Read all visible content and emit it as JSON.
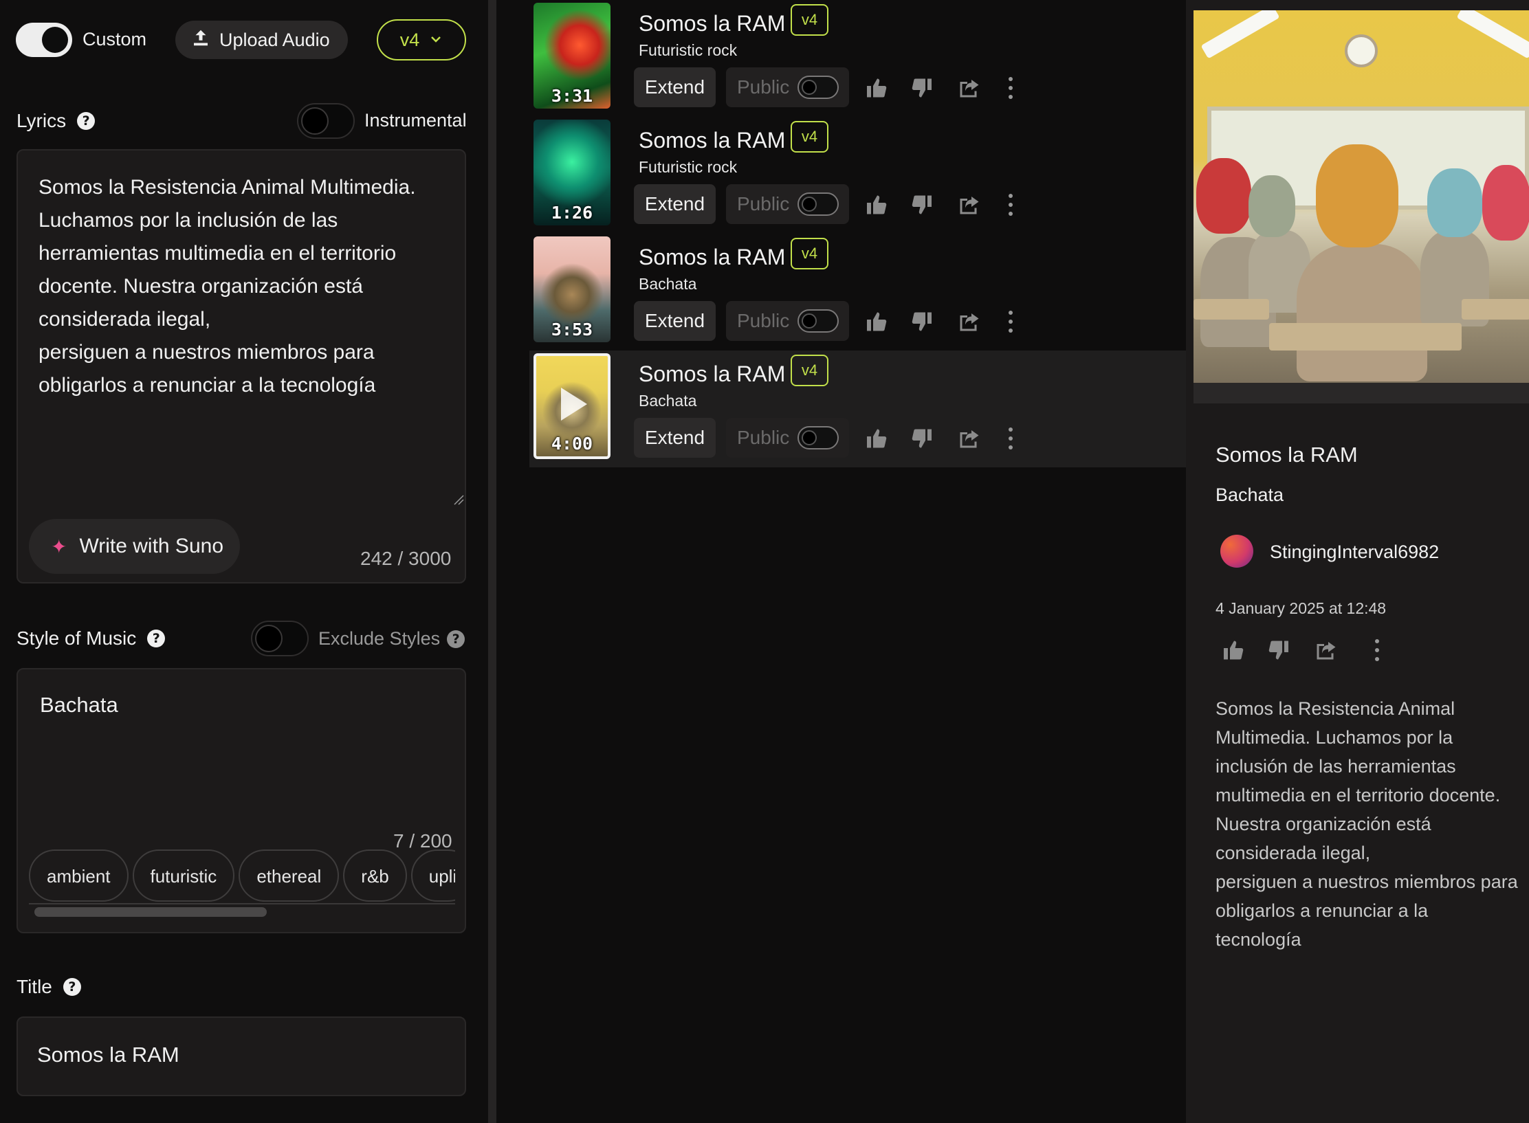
{
  "top": {
    "custom_label": "Custom",
    "upload_label": "Upload Audio",
    "version": "v4"
  },
  "lyrics": {
    "label": "Lyrics",
    "instrumental_label": "Instrumental",
    "text": "Somos la Resistencia Animal Multimedia.\nLuchamos por la inclusión de las herramientas multimedia en el territorio docente. Nuestra organización está considerada ilegal,\npersiguen a nuestros miembros para obligarlos a renunciar a la tecnología",
    "write_label": "Write with Suno",
    "counter": "242 / 3000"
  },
  "style": {
    "label": "Style of Music",
    "exclude_label": "Exclude Styles",
    "value": "Bachata",
    "counter": "7 / 200",
    "chips": [
      "ambient",
      "futuristic",
      "ethereal",
      "r&b",
      "upli"
    ]
  },
  "title_section": {
    "label": "Title",
    "value": "Somos la RAM"
  },
  "songs": [
    {
      "title": "Somos la RAM",
      "badge": "v4",
      "style": "Futuristic rock",
      "duration": "3:31",
      "extend": "Extend",
      "public": "Public"
    },
    {
      "title": "Somos la RAM",
      "badge": "v4",
      "style": "Futuristic rock",
      "duration": "1:26",
      "extend": "Extend",
      "public": "Public"
    },
    {
      "title": "Somos la RAM",
      "badge": "v4",
      "style": "Bachata",
      "duration": "3:53",
      "extend": "Extend",
      "public": "Public"
    },
    {
      "title": "Somos la RAM",
      "badge": "v4",
      "style": "Bachata",
      "duration": "4:00",
      "extend": "Extend",
      "public": "Public"
    }
  ],
  "detail": {
    "title": "Somos la RAM",
    "style": "Bachata",
    "user": "StingingInterval6982",
    "date": "4 January 2025 at 12:48",
    "lyrics": "Somos la Resistencia Animal Multimedia. Luchamos por la inclusión de las herramientas multimedia en el territorio docente. Nuestra organización está considerada ilegal,\npersiguen a nuestros miembros para obligarlos a renunciar a la tecnología"
  },
  "colors": {
    "accent": "#c2e04a",
    "spark": "#ea4d8c",
    "background": "#0f0e0e",
    "panel": "#1c1a1a"
  }
}
